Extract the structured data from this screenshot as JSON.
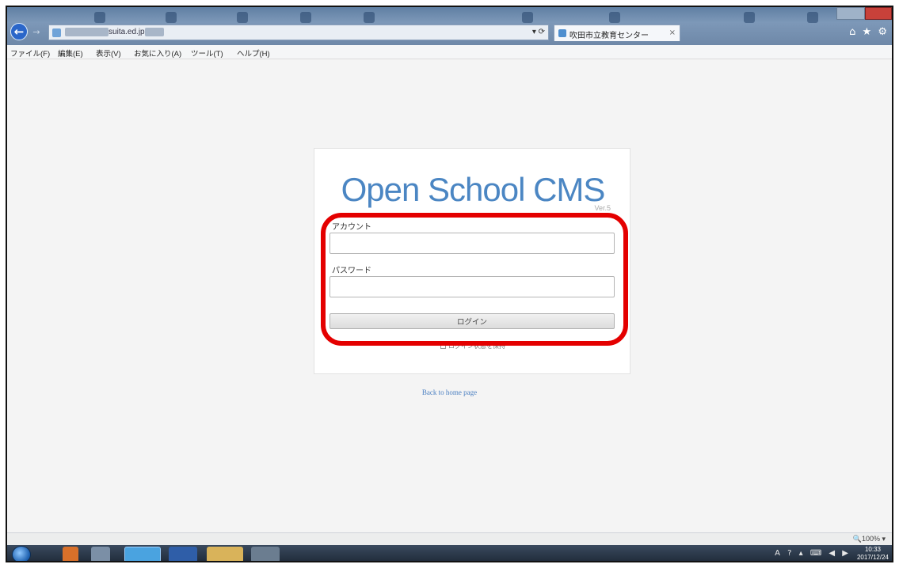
{
  "browser": {
    "url_visible": "suita.ed.jp",
    "address_controls": "▾ ⟳",
    "tab_title": "吹田市立教育センター",
    "tab_close": "×",
    "toolbar_icons": "⌂ ★ ⚙"
  },
  "menu": [
    {
      "label": "ファイル(F)"
    },
    {
      "label": "編集(E)"
    },
    {
      "label": "表示(V)"
    },
    {
      "label": "お気に入り(A)"
    },
    {
      "label": "ツール(T)"
    },
    {
      "label": "ヘルプ(H)"
    }
  ],
  "login": {
    "logo": "Open School CMS",
    "version": "Ver.5",
    "account_label": "アカウント",
    "account_value": "",
    "password_label": "パスワード",
    "password_value": "",
    "login_button": "ログイン",
    "keep_login": "ログイン状態を保持"
  },
  "back_link": "Back to home page",
  "status": {
    "zoom": "🔍100% ▾"
  },
  "taskbar": {
    "time": "10:33",
    "date": "2017/12/24",
    "tray_icons": "A ? ▴ ⌨ ◀ ▶"
  },
  "colors": {
    "logo": "#4b86c3",
    "highlight": "#e40000",
    "link": "#4a7fc1"
  }
}
